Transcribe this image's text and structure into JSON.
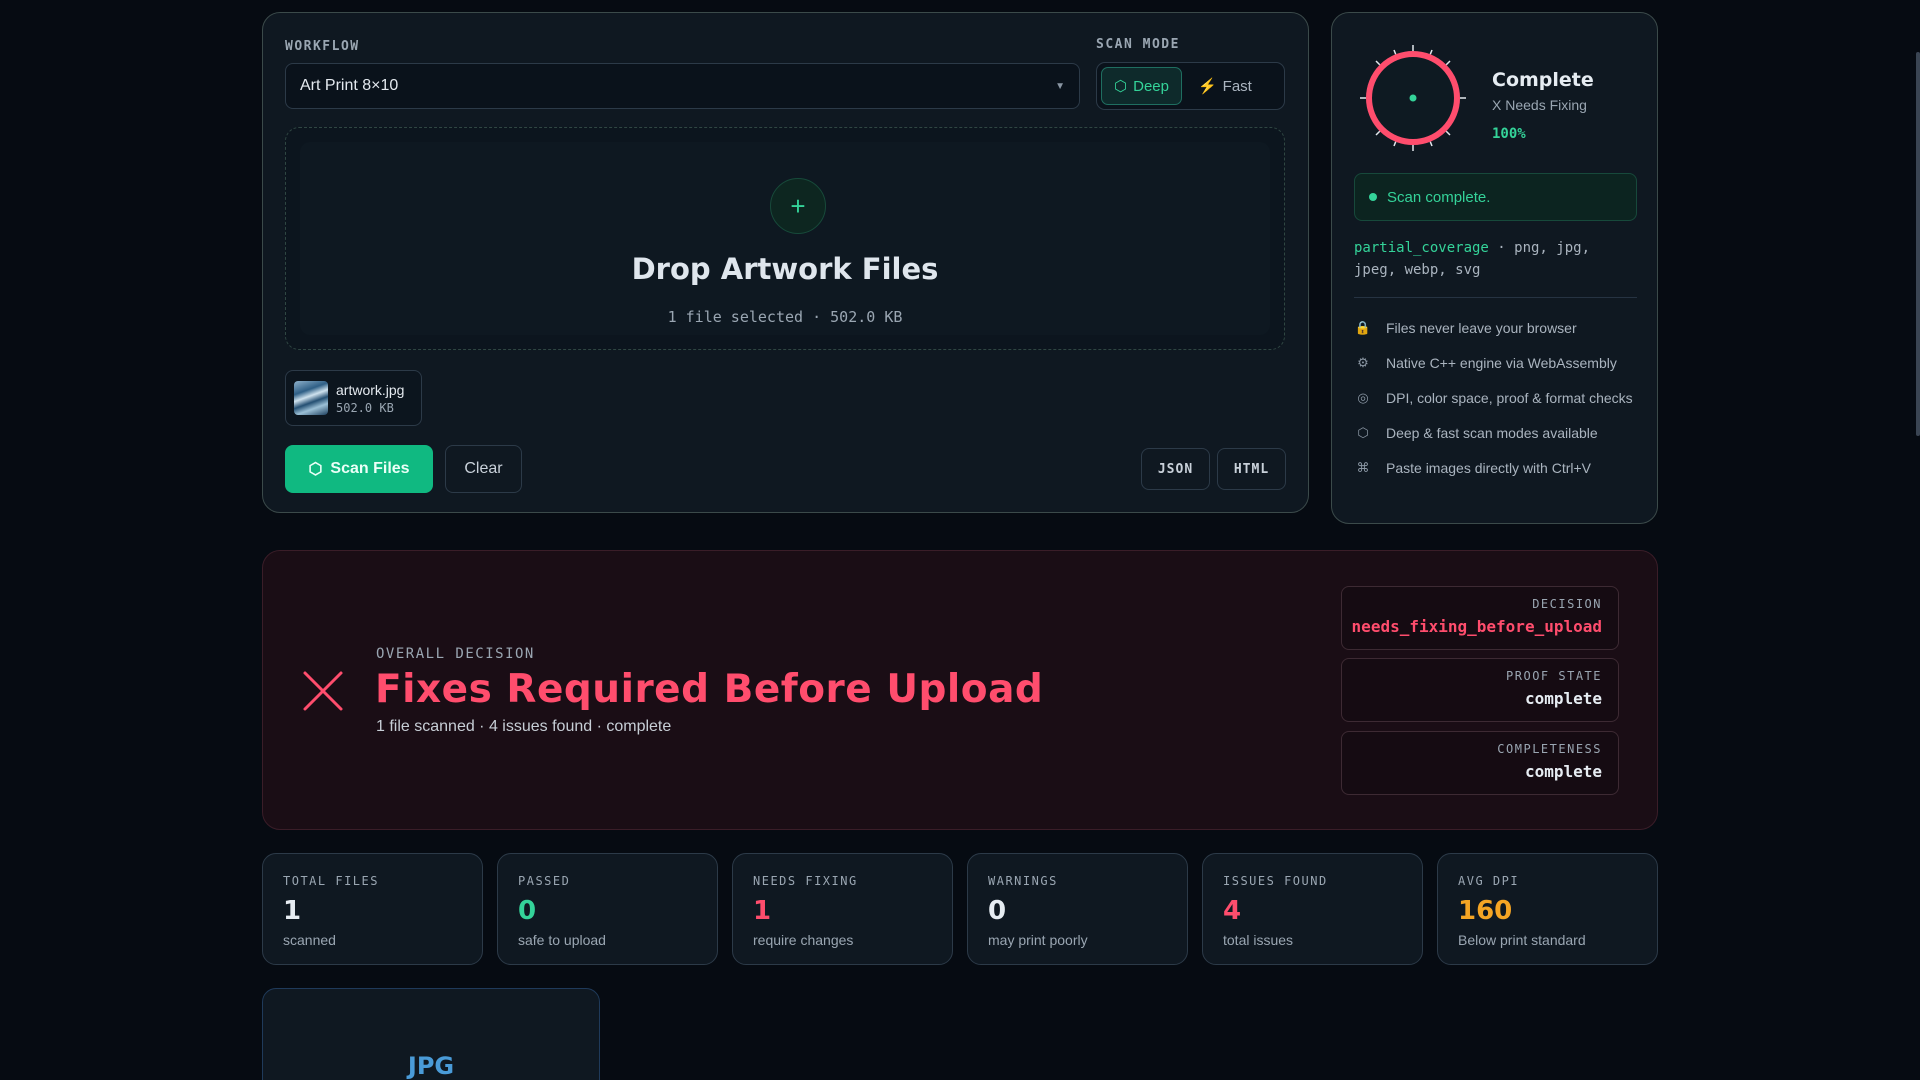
{
  "upload": {
    "workflow_label": "WORKFLOW",
    "workflow_value": "Art Print 8×10",
    "scan_mode_label": "SCAN MODE",
    "modes": [
      {
        "label": "Deep",
        "icon": "hexagon-icon",
        "active": true
      },
      {
        "label": "Fast",
        "icon": "bolt-icon",
        "active": false
      }
    ],
    "drop_title": "Drop Artwork Files",
    "drop_sub": "1 file selected · 502.0 KB",
    "file": {
      "name": "artwork.jpg",
      "size": "502.0 KB"
    },
    "scan_button": "Scan Files",
    "clear_button": "Clear",
    "export_json": "JSON",
    "export_html": "HTML"
  },
  "status": {
    "title": "Complete",
    "subtitle": "X Needs Fixing",
    "percent": "100%",
    "progress": 1.0,
    "message": "Scan complete.",
    "coverage_key": "partial_coverage",
    "formats": " · png, jpg, jpeg, webp, svg",
    "features": [
      {
        "icon": "lock-icon",
        "glyph": "🔒",
        "text": "Files never leave your browser"
      },
      {
        "icon": "gear-icon",
        "glyph": "⚙",
        "text": "Native C++ engine via WebAssembly"
      },
      {
        "icon": "target-icon",
        "glyph": "◎",
        "text": "DPI, color space, proof & format checks"
      },
      {
        "icon": "hexagon-icon",
        "glyph": "⬡",
        "text": "Deep & fast scan modes available"
      },
      {
        "icon": "command-icon",
        "glyph": "⌘",
        "text": "Paste images directly with Ctrl+V"
      }
    ]
  },
  "decision": {
    "label": "OVERALL DECISION",
    "title": "Fixes Required Before Upload",
    "summary": "1 file scanned · 4 issues found · complete",
    "cards": [
      {
        "key": "DECISION",
        "value": "needs_fixing_before_upload"
      },
      {
        "key": "PROOF STATE",
        "value": "complete"
      },
      {
        "key": "COMPLETENESS",
        "value": "complete"
      }
    ]
  },
  "stats": [
    {
      "key": "TOTAL FILES",
      "value": "1",
      "sub": "scanned",
      "color": "#e6ecf2"
    },
    {
      "key": "PASSED",
      "value": "0",
      "sub": "safe to upload",
      "color": "#34d399"
    },
    {
      "key": "NEEDS FIXING",
      "value": "1",
      "sub": "require changes",
      "color": "#ff4d6d"
    },
    {
      "key": "WARNINGS",
      "value": "0",
      "sub": "may print poorly",
      "color": "#e6ecf2"
    },
    {
      "key": "ISSUES FOUND",
      "value": "4",
      "sub": "total issues",
      "color": "#ff4d6d"
    },
    {
      "key": "AVG DPI",
      "value": "160",
      "sub": "Below print standard",
      "color": "#f5a524"
    }
  ],
  "file_card": {
    "type": "JPG"
  },
  "colors": {
    "accent": "#10b981",
    "danger": "#ff4d6d",
    "warning": "#f5a524",
    "info": "#4a9bd8"
  }
}
